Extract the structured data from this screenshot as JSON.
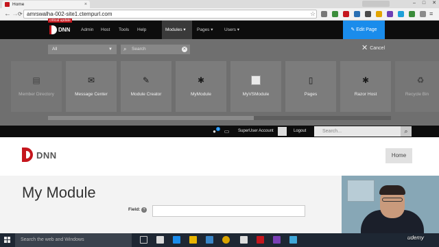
{
  "browser": {
    "tab_title": "Home",
    "tab_close": "×",
    "url": "amrswalha-002-site1.ctempurl.com",
    "back": "←",
    "forward": "→",
    "reload": "⟳"
  },
  "controlbar": {
    "logo_text": "DNN",
    "critical_badge": "critical update",
    "menu": [
      {
        "label": "Admin"
      },
      {
        "label": "Host"
      },
      {
        "label": "Tools"
      },
      {
        "label": "Help"
      },
      {
        "label": "Modules ▾"
      },
      {
        "label": "Pages ▾"
      },
      {
        "label": "Users ▾"
      }
    ],
    "edit_page": "✎ Edit Page"
  },
  "module_panel": {
    "filter_value": "All",
    "search_placeholder": "Search",
    "cancel_label": "Cancel",
    "modules": [
      {
        "label": "Member Directory",
        "icon": "member-directory-icon"
      },
      {
        "label": "Message Center",
        "icon": "message-center-icon"
      },
      {
        "label": "Module Creator",
        "icon": "module-creator-icon"
      },
      {
        "label": "MyModule",
        "icon": "puzzle-icon"
      },
      {
        "label": "MyVSModule",
        "icon": "image-placeholder-icon"
      },
      {
        "label": "Pages",
        "icon": "page-icon"
      },
      {
        "label": "Razor Host",
        "icon": "puzzle-icon"
      },
      {
        "label": "Recycle Bin",
        "icon": "recycle-bin-icon"
      }
    ]
  },
  "personabar": {
    "notifications_count": "1",
    "user_link": "SuperUser Account",
    "logout": "Logout",
    "search_placeholder": "Search..."
  },
  "page": {
    "logo_text": "DNN",
    "home_button": "Home",
    "title": "My Module",
    "field_label": "Field:",
    "help_icon": "?"
  },
  "taskbar": {
    "search_placeholder": "Search the web and Windows"
  },
  "watermark": "udemy",
  "colors": {
    "dnn_red": "#c5161d",
    "edit_blue": "#1a8ceb",
    "panel_gray": "#6f6f6f"
  }
}
